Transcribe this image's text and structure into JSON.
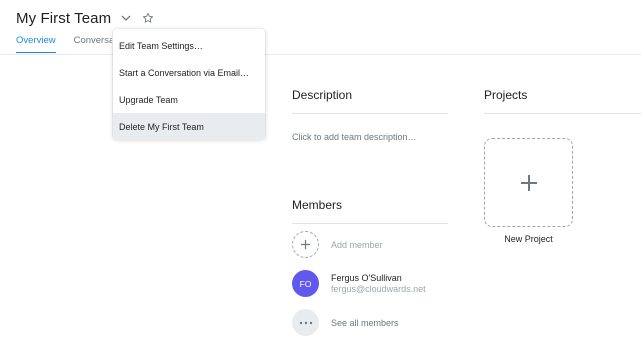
{
  "header": {
    "team_name": "My First Team",
    "tabs": [
      {
        "label": "Overview",
        "active": true
      },
      {
        "label": "Conversations",
        "active": false
      }
    ]
  },
  "menu": {
    "items": [
      {
        "label": "Edit Team Settings…"
      },
      {
        "label": "Start a Conversation via Email…"
      },
      {
        "label": "Upgrade Team"
      },
      {
        "label": "Delete My First Team",
        "highlighted": true
      }
    ]
  },
  "description": {
    "title": "Description",
    "placeholder": "Click to add team description…"
  },
  "projects": {
    "title": "Projects",
    "new_project_label": "New Project"
  },
  "members": {
    "title": "Members",
    "add_label": "Add member",
    "list": [
      {
        "initials": "FO",
        "name": "Fergus O'Sullivan",
        "email": "fergus@cloudwards.net",
        "avatar_color": "#6158ee"
      }
    ],
    "see_all_label": "See all members"
  },
  "colors": {
    "accent": "#1a8fd4",
    "menu_highlight": "#e8ecee"
  }
}
